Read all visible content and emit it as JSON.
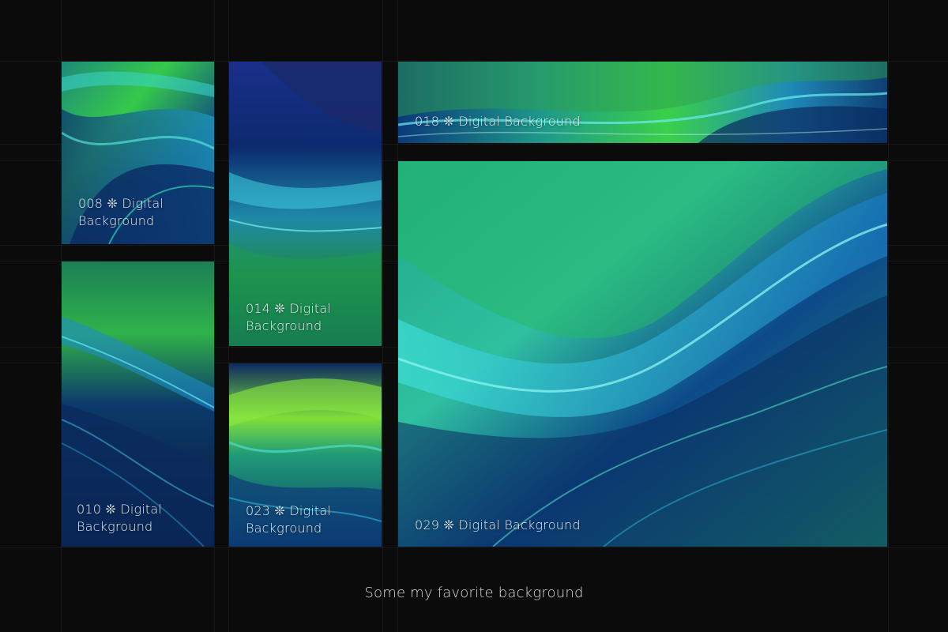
{
  "gallery": {
    "tiles": [
      {
        "caption": "008 ❊ Digital Background"
      },
      {
        "caption": "010 ❊ Digital Background"
      },
      {
        "caption": "014 ❊ Digital Background"
      },
      {
        "caption": "023 ❊ Digital Background"
      },
      {
        "caption": "018 ❊ Digital Background"
      },
      {
        "caption": "029 ❊ Digital Background"
      }
    ]
  },
  "footer": {
    "text": "Some my favorite background"
  },
  "colors": {
    "page_background": "#0b0b0b",
    "deep_navy": "#0a1a3a",
    "royal_blue": "#1446a0",
    "teal": "#1fb5b0",
    "cyan": "#2fe0d8",
    "green": "#2ec44a",
    "lime": "#7fe03a",
    "caption_text": "#e6eef2"
  }
}
